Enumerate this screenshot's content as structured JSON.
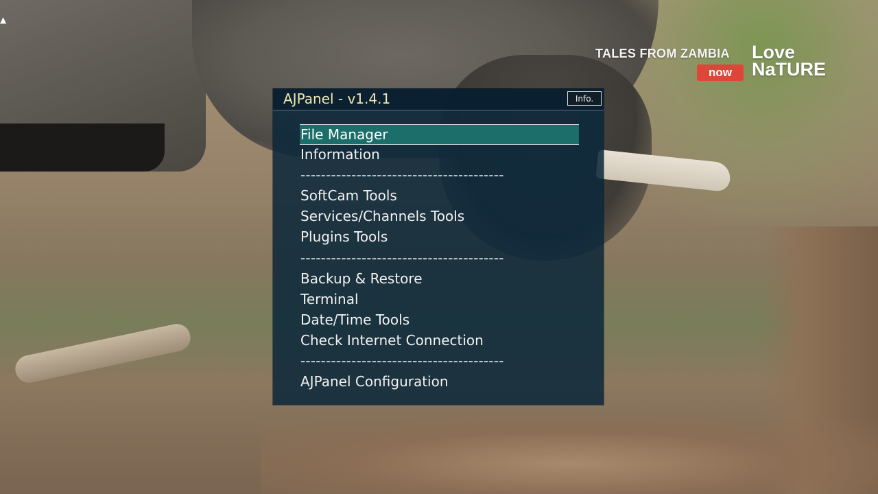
{
  "background": {
    "overlay_caption": "TALES FROM ZAMBIA",
    "overlay_badge": "now",
    "overlay_brand_line1": "Love",
    "overlay_brand_line2": "NaTURE"
  },
  "panel": {
    "title": "AJPanel - v1.4.1",
    "info_button": "Info.",
    "selected_index": 0,
    "items": [
      {
        "label": "File Manager",
        "type": "item"
      },
      {
        "label": "Information",
        "type": "item"
      },
      {
        "label": "----------------------------------------",
        "type": "separator"
      },
      {
        "label": "SoftCam Tools",
        "type": "item"
      },
      {
        "label": "Services/Channels Tools",
        "type": "item"
      },
      {
        "label": "Plugins Tools",
        "type": "item"
      },
      {
        "label": "----------------------------------------",
        "type": "separator"
      },
      {
        "label": "Backup & Restore",
        "type": "item"
      },
      {
        "label": "Terminal",
        "type": "item"
      },
      {
        "label": "Date/Time Tools",
        "type": "item"
      },
      {
        "label": "Check Internet Connection",
        "type": "item"
      },
      {
        "label": "----------------------------------------",
        "type": "separator"
      },
      {
        "label": "AJPanel Configuration",
        "type": "item"
      }
    ],
    "colors": {
      "title": "#f1e8b0",
      "selection": "#1c6e6a",
      "background": "#0a283a"
    }
  }
}
